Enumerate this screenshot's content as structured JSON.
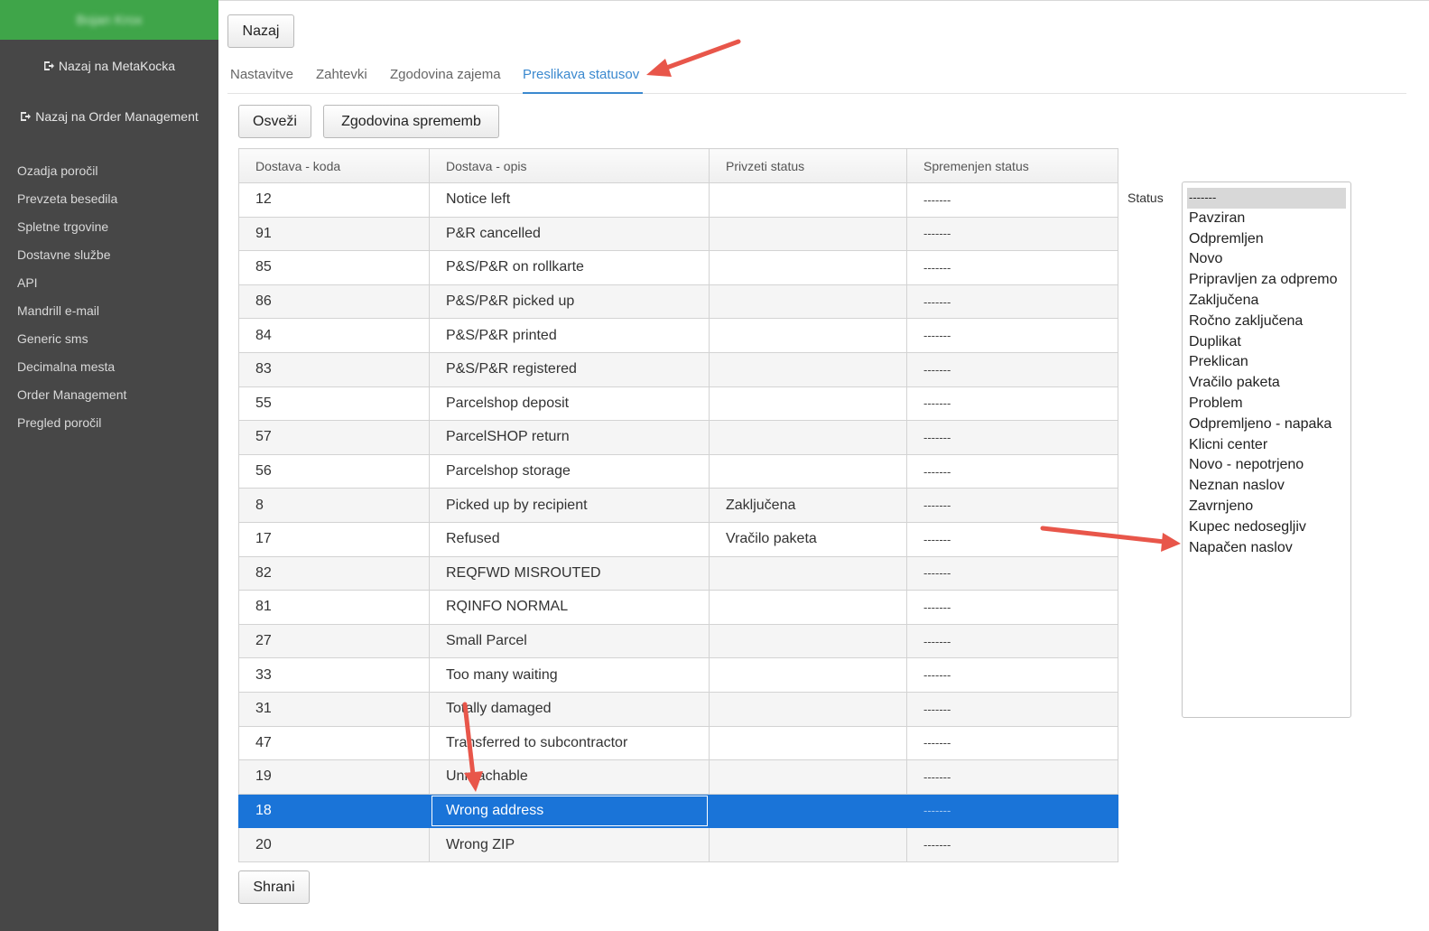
{
  "sidebar": {
    "brand": "Bojan Krox",
    "link_metakocka": "Nazaj na MetaKocka",
    "link_order_management": "Nazaj na Order Management",
    "nav": [
      "Ozadja poročil",
      "Prevzeta besedila",
      "Spletne trgovine",
      "Dostavne službe",
      "API",
      "Mandrill e-mail",
      "Generic sms",
      "Decimalna mesta",
      "Order Management",
      "Pregled poročil"
    ]
  },
  "toolbar": {
    "back_label": "Nazaj",
    "refresh_label": "Osveži",
    "history_label": "Zgodovina sprememb",
    "save_label": "Shrani"
  },
  "tabs": [
    {
      "label": "Nastavitve",
      "active": false
    },
    {
      "label": "Zahtevki",
      "active": false
    },
    {
      "label": "Zgodovina zajema",
      "active": false
    },
    {
      "label": "Preslikava statusov",
      "active": true
    }
  ],
  "table": {
    "columns": [
      "Dostava - koda",
      "Dostava - opis",
      "Privzeti status",
      "Spremenjen status"
    ],
    "rows": [
      [
        "12",
        "Notice left",
        "",
        "-------"
      ],
      [
        "91",
        "P&R cancelled",
        "",
        "-------"
      ],
      [
        "85",
        "P&S/P&R on rollkarte",
        "",
        "-------"
      ],
      [
        "86",
        "P&S/P&R picked up",
        "",
        "-------"
      ],
      [
        "84",
        "P&S/P&R printed",
        "",
        "-------"
      ],
      [
        "83",
        "P&S/P&R registered",
        "",
        "-------"
      ],
      [
        "55",
        "Parcelshop deposit",
        "",
        "-------"
      ],
      [
        "57",
        "ParcelSHOP return",
        "",
        "-------"
      ],
      [
        "56",
        "Parcelshop storage",
        "",
        "-------"
      ],
      [
        "8",
        "Picked up by recipient",
        "Zaključena",
        "-------"
      ],
      [
        "17",
        "Refused",
        "Vračilo paketa",
        "-------"
      ],
      [
        "82",
        "REQFWD MISROUTED",
        "",
        "-------"
      ],
      [
        "81",
        "RQINFO NORMAL",
        "",
        "-------"
      ],
      [
        "27",
        "Small Parcel",
        "",
        "-------"
      ],
      [
        "33",
        "Too many waiting",
        "",
        "-------"
      ],
      [
        "31",
        "Totally damaged",
        "",
        "-------"
      ],
      [
        "47",
        "Transferred to subcontractor",
        "",
        "-------"
      ],
      [
        "19",
        "Unreachable",
        "",
        "-------"
      ],
      [
        "18",
        "Wrong address",
        "",
        "-------"
      ],
      [
        "20",
        "Wrong ZIP",
        "",
        "-------"
      ]
    ],
    "selected_row": 18
  },
  "status_panel": {
    "label": "Status",
    "options": [
      "-------",
      "Pavziran",
      "Odpremljen",
      "Novo",
      "Pripravljen za odpremo",
      "Zaključena",
      "Ročno zaključena",
      "Duplikat",
      "Preklican",
      "Vračilo paketa",
      "Problem",
      "Odpremljeno - napaka",
      "Klicni center",
      "Novo - nepotrjeno",
      "Neznan naslov",
      "Zavrnjeno",
      "Kupec nedosegljiv",
      "Napačen naslov"
    ],
    "selected_option": "-------"
  },
  "colors": {
    "brand": "#3fa549",
    "sidebar_bg": "#474747",
    "accent": "#3b89cf",
    "selected_row": "#1a74d8",
    "annotation_arrow": "#e8564a"
  }
}
